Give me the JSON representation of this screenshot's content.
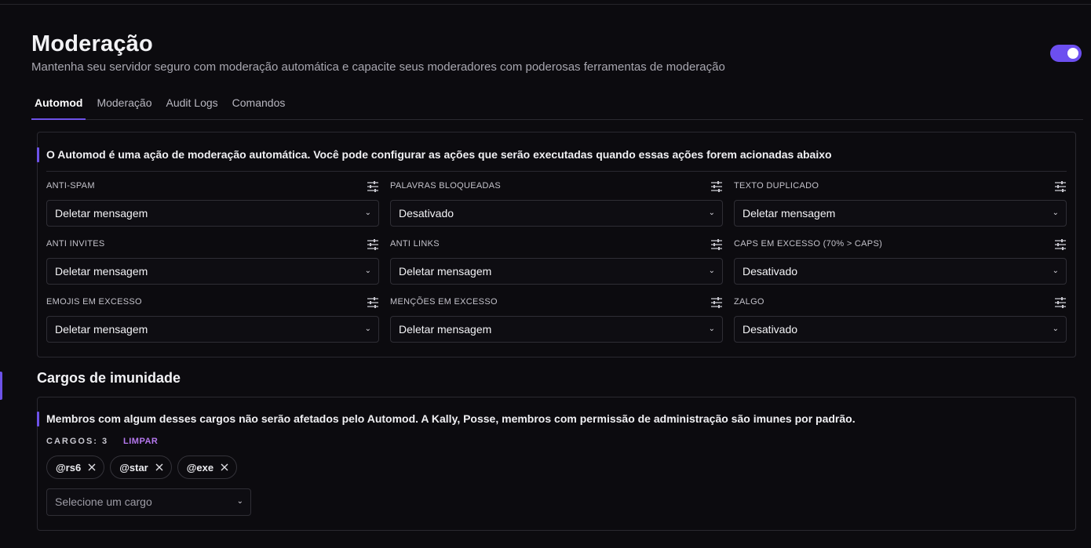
{
  "header": {
    "title": "Moderação",
    "subtitle": "Mantenha seu servidor seguro com moderação automática e capacite seus moderadores com poderosas ferramentas de moderação",
    "enabled": true
  },
  "tabs": [
    {
      "label": "Automod",
      "active": true
    },
    {
      "label": "Moderação",
      "active": false
    },
    {
      "label": "Audit Logs",
      "active": false
    },
    {
      "label": "Comandos",
      "active": false
    }
  ],
  "automod": {
    "info": "O Automod é uma ação de moderação automática. Você pode configurar as ações que serão executadas quando essas ações forem acionadas abaixo",
    "rules": [
      {
        "label": "ANTI-SPAM",
        "value": "Deletar mensagem"
      },
      {
        "label": "PALAVRAS BLOQUEADAS",
        "value": "Desativado"
      },
      {
        "label": "TEXTO DUPLICADO",
        "value": "Deletar mensagem"
      },
      {
        "label": "ANTI INVITES",
        "value": "Deletar mensagem"
      },
      {
        "label": "ANTI LINKS",
        "value": "Deletar mensagem"
      },
      {
        "label": "CAPS EM EXCESSO (70% > CAPS)",
        "value": "Desativado"
      },
      {
        "label": "EMOJIS EM EXCESSO",
        "value": "Deletar mensagem"
      },
      {
        "label": "MENÇÕES EM EXCESSO",
        "value": "Deletar mensagem"
      },
      {
        "label": "ZALGO",
        "value": "Desativado"
      }
    ]
  },
  "immunity": {
    "title": "Cargos de imunidade",
    "info": "Membros com algum desses cargos não serão afetados pelo Automod. A Kally, Posse, membros com permissão de administração são imunes por padrão.",
    "count_label": "CARGOS: 3",
    "clear_label": "LIMPAR",
    "roles": [
      "@rs6",
      "@star",
      "@exe"
    ],
    "select_placeholder": "Selecione um cargo"
  },
  "colors": {
    "accent": "#6d52e8",
    "link": "#b678ef",
    "background": "#0c0b0f"
  },
  "icons": {
    "rule_settings": "sliders-icon",
    "dropdown": "chevron-down-icon",
    "remove_role": "close-icon"
  }
}
